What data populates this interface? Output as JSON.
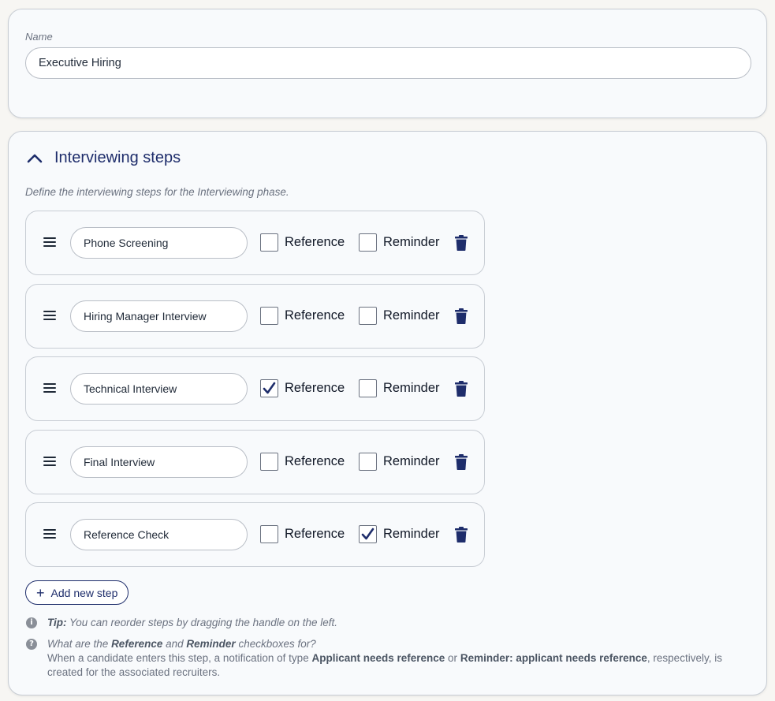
{
  "name_field": {
    "label": "Name",
    "value": "Executive Hiring"
  },
  "interviewing": {
    "title": "Interviewing steps",
    "description": "Define the interviewing steps for the Interviewing phase.",
    "reference_label": "Reference",
    "reminder_label": "Reminder",
    "steps": [
      {
        "name": "Phone Screening",
        "reference": false,
        "reminder": false
      },
      {
        "name": "Hiring Manager Interview",
        "reference": false,
        "reminder": false
      },
      {
        "name": "Technical Interview",
        "reference": true,
        "reminder": false
      },
      {
        "name": "Final Interview",
        "reference": false,
        "reminder": false
      },
      {
        "name": "Reference Check",
        "reference": false,
        "reminder": true
      }
    ],
    "add_button_label": "Add new step"
  },
  "hints": {
    "tip_label": "Tip:",
    "tip_text": "You can reorder steps by dragging the handle on the left.",
    "help_q_1": "What are the",
    "help_q_ref": "Reference",
    "help_q_and": "and",
    "help_q_rem": "Reminder",
    "help_q_2": "checkboxes for?",
    "help_a_1": "When a candidate enters this step, a notification of type",
    "help_a_type1": "Applicant needs reference",
    "help_a_or": "or",
    "help_a_type2": "Reminder: applicant needs reference",
    "help_a_2": ", respectively, is created for the associated recruiters."
  },
  "colors": {
    "accent": "#1e2d6b",
    "background": "#f7f6f3",
    "card": "#f8fafc"
  },
  "icons": {
    "collapse": "chevron-up-icon",
    "drag": "drag-handle-icon",
    "delete": "trash-icon",
    "add": "plus-icon",
    "tip": "info-icon",
    "help": "question-icon"
  }
}
